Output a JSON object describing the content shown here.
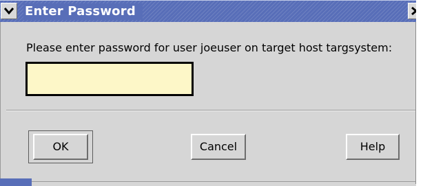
{
  "window": {
    "title": "Enter Password",
    "accent_color": "#586eb8"
  },
  "titlebar": {
    "menu_icon": "chevron-down-icon",
    "close_icon": "close-icon"
  },
  "dialog": {
    "prompt": "Please enter password for user joeuser on target host targsystem:",
    "password_value": "",
    "input_background": "#fdf7c8"
  },
  "buttons": {
    "ok_label": "OK",
    "cancel_label": "Cancel",
    "help_label": "Help"
  }
}
